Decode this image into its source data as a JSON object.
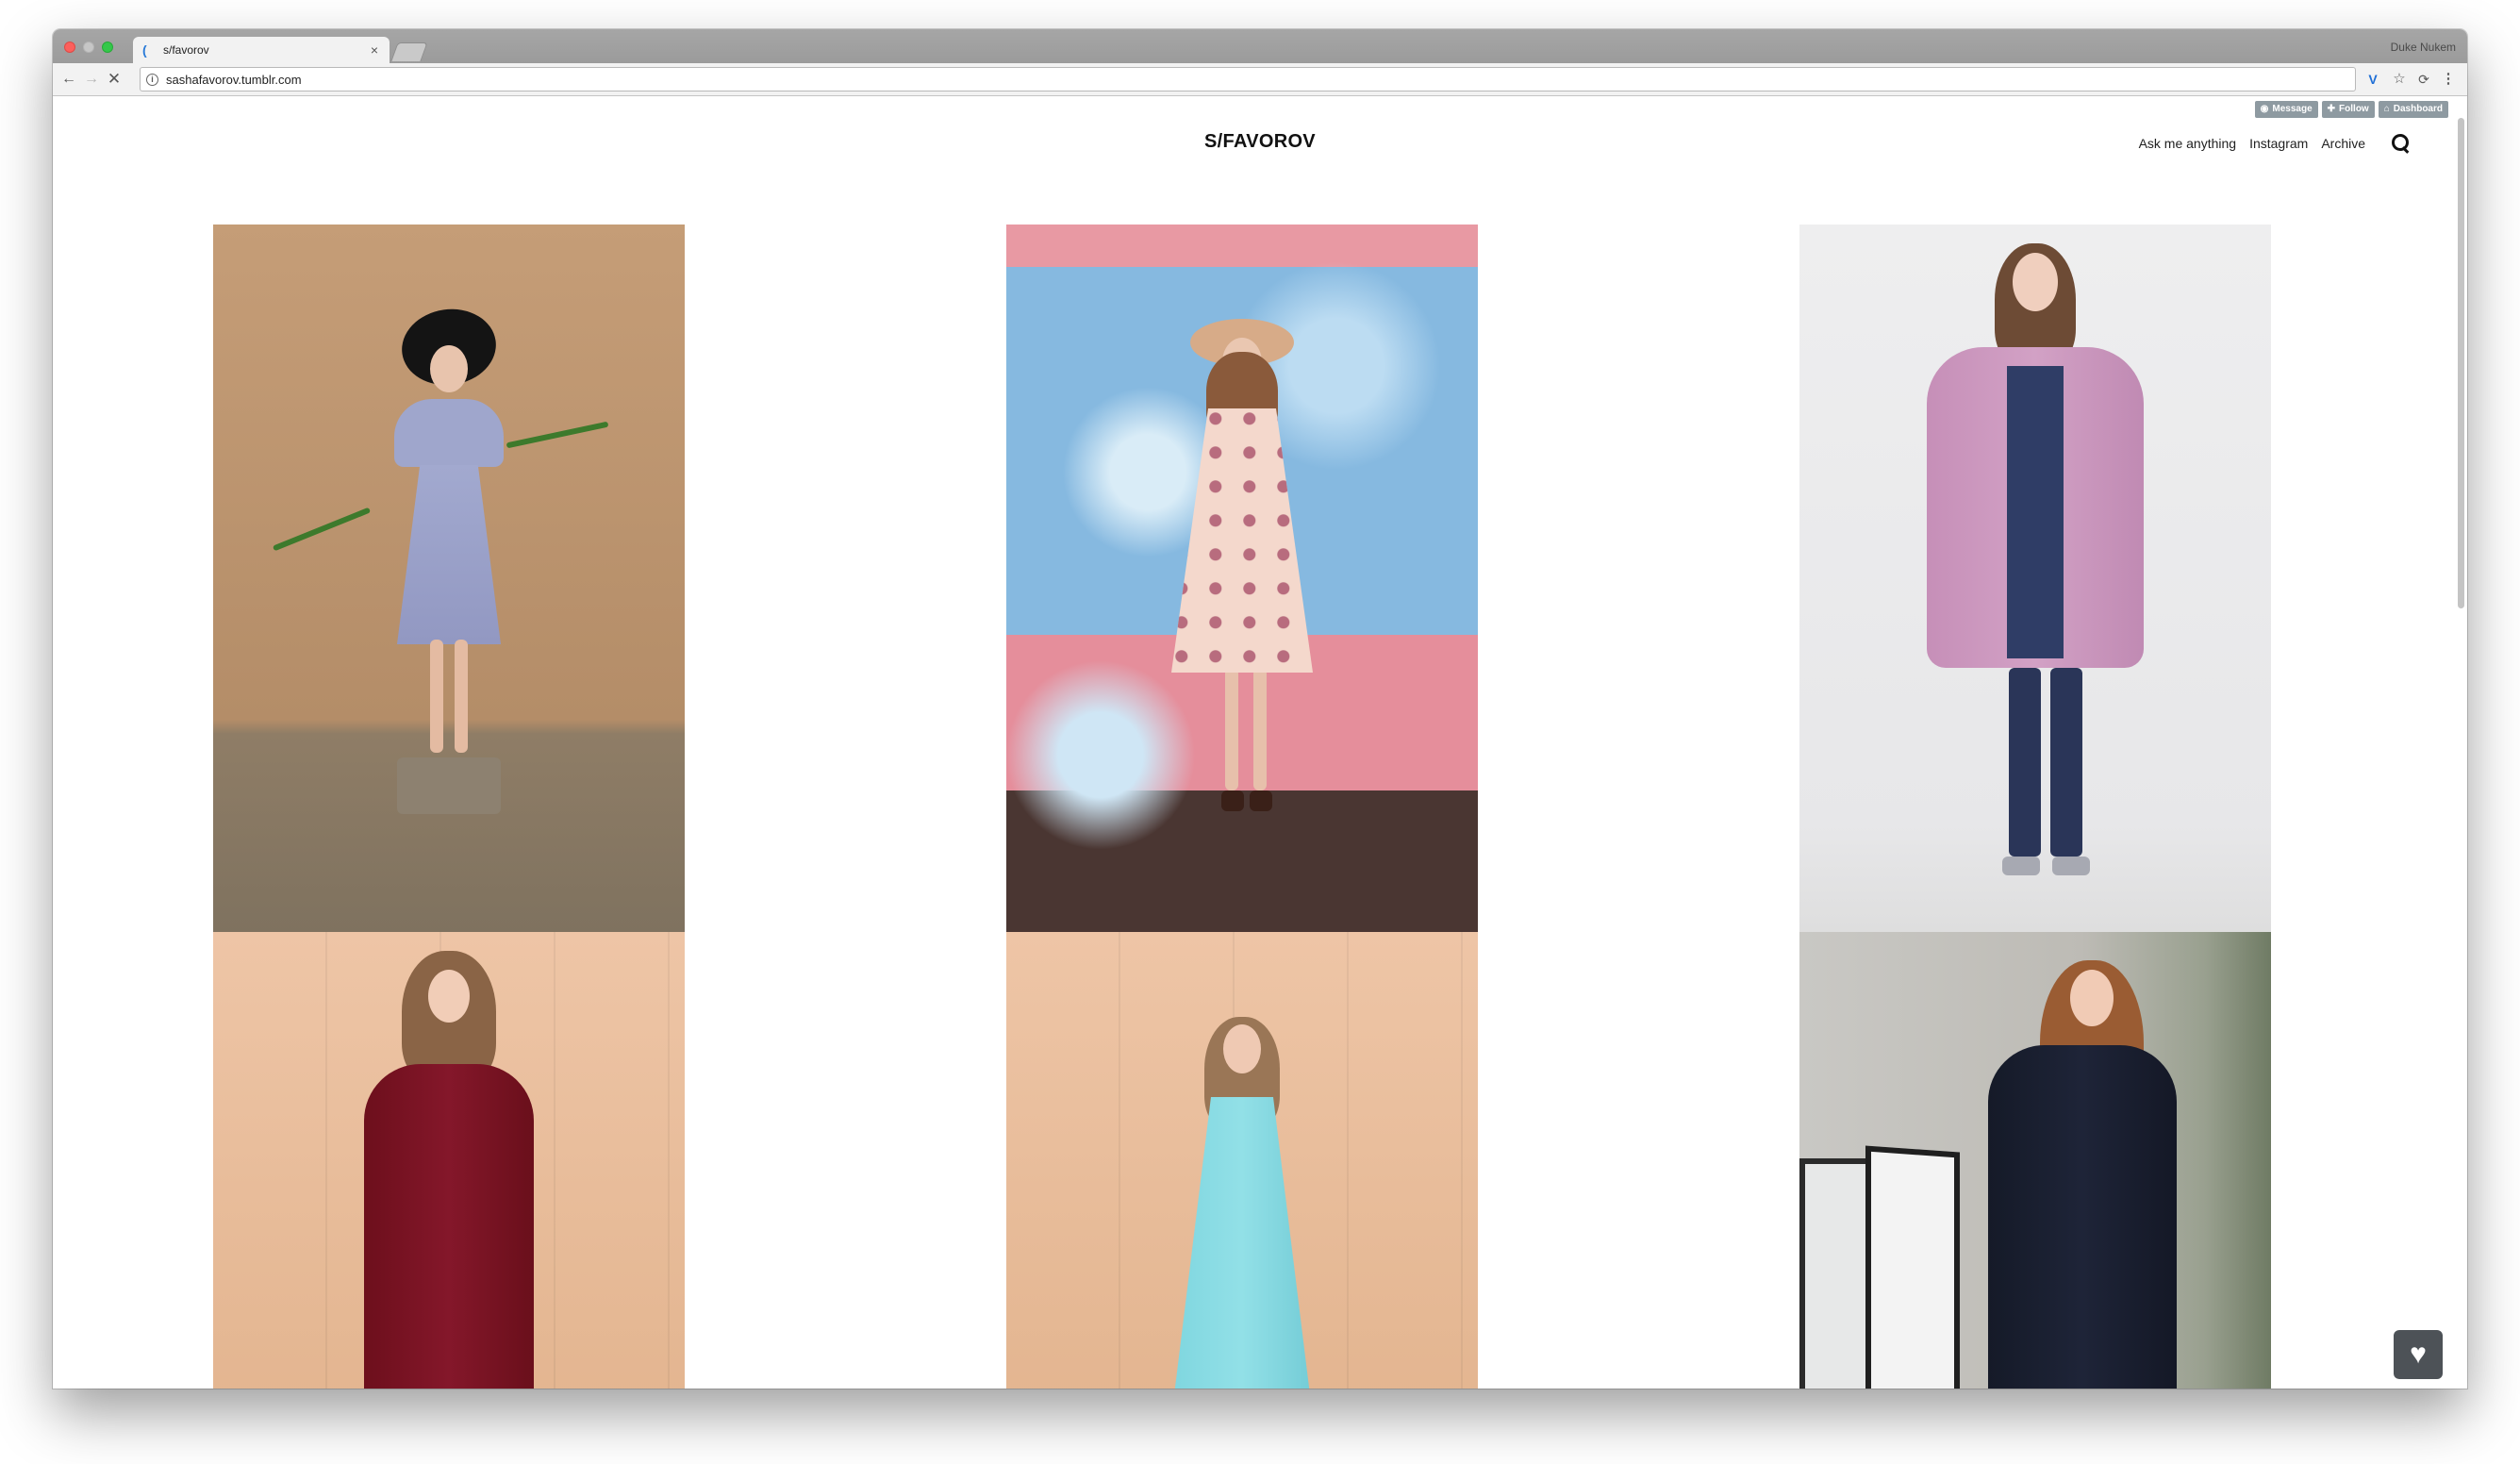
{
  "browser": {
    "tab_title": "s/favorov",
    "tab_close": "×",
    "profile_name": "Duke Nukem",
    "url": "sashafavorov.tumblr.com",
    "nav_back": "←",
    "nav_forward": "→",
    "nav_stop": "✕",
    "info": "i",
    "ext_v": "V",
    "ext_star": "☆",
    "ext_sync": "⟳",
    "ext_menu": "⋮"
  },
  "tumblr_controls": [
    {
      "label": "Message",
      "icon": "message-icon"
    },
    {
      "label": "Follow",
      "icon": "plus-icon"
    },
    {
      "label": "Dashboard",
      "icon": "home-icon"
    }
  ],
  "blog": {
    "title": "S/FAVOROV",
    "nav": [
      "Ask me anything",
      "Instagram",
      "Archive"
    ]
  },
  "photos": [
    {
      "name": "photo-lavender-dress-hat"
    },
    {
      "name": "photo-floral-dress-blue-backdrop"
    },
    {
      "name": "photo-pink-fur-coat"
    },
    {
      "name": "photo-burgundy-dress"
    },
    {
      "name": "photo-aqua-dress"
    },
    {
      "name": "photo-navy-coat"
    }
  ],
  "like_button": "♥",
  "colors": {
    "tumblr_button": "#8e9aa1",
    "like_button": "#4d5257"
  }
}
